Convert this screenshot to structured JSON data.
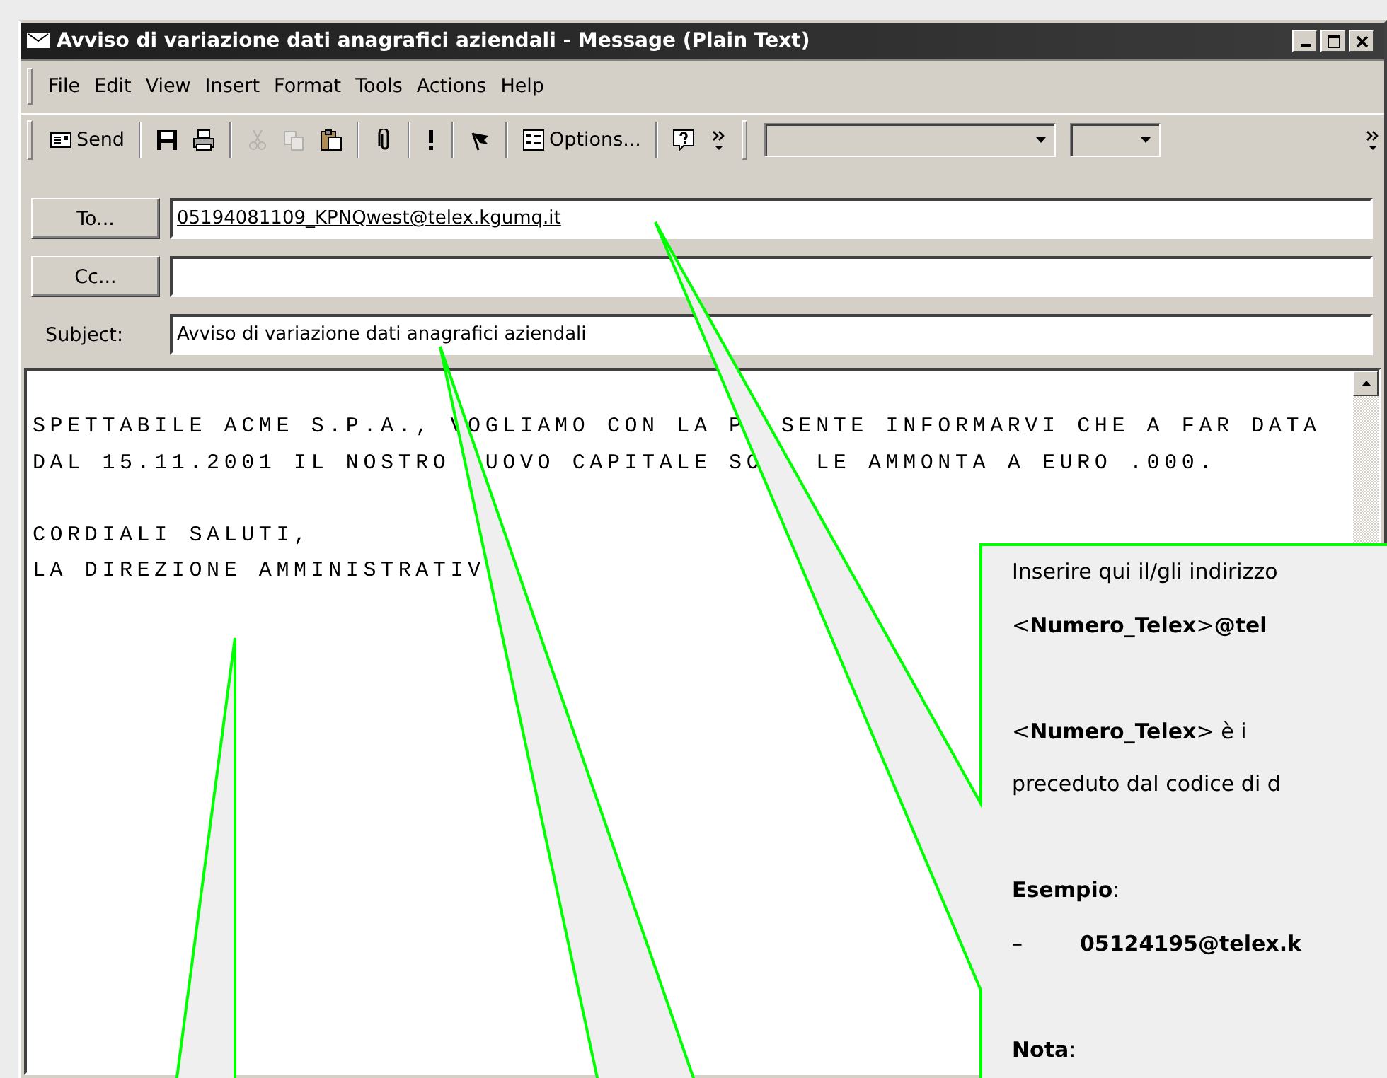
{
  "window": {
    "title": "Avviso di variazione dati anagrafici aziendali - Message (Plain Text)"
  },
  "menu": [
    "File",
    "Edit",
    "View",
    "Insert",
    "Format",
    "Tools",
    "Actions",
    "Help"
  ],
  "toolbar": [
    {
      "kind": "send",
      "label": "Send",
      "disabled": false
    },
    {
      "kind": "separator"
    },
    {
      "kind": "save",
      "disabled": false
    },
    {
      "kind": "print",
      "disabled": false
    },
    {
      "kind": "separator"
    },
    {
      "kind": "cut",
      "disabled": true
    },
    {
      "kind": "copy",
      "disabled": true
    },
    {
      "kind": "paste",
      "disabled": false
    },
    {
      "kind": "separator"
    },
    {
      "kind": "attach",
      "disabled": false
    },
    {
      "kind": "separator"
    },
    {
      "kind": "importance",
      "disabled": false
    },
    {
      "kind": "separator"
    },
    {
      "kind": "flag",
      "disabled": false
    },
    {
      "kind": "separator"
    },
    {
      "kind": "options",
      "label": "Options...",
      "disabled": false
    },
    {
      "kind": "separator"
    },
    {
      "kind": "help",
      "disabled": false
    },
    {
      "kind": "more",
      "disabled": false
    },
    {
      "kind": "grip"
    },
    {
      "kind": "combo"
    },
    {
      "kind": "combo_small"
    },
    {
      "kind": "more",
      "disabled": false
    }
  ],
  "fields": [
    {
      "kind": "button",
      "label": "To...",
      "value": "05194081109_KPNQwest@telex.kgumq.it",
      "underlined": true
    },
    {
      "kind": "button",
      "label": "Cc..."
    },
    {
      "kind": "label",
      "label": "Subject:",
      "value": "Avviso di variazione dati anagrafici aziendali",
      "underlined": false
    }
  ],
  "message": {
    "paragraphs": [
      {
        "lines": [
          "SPETTABILE ACME S.P.A., VOGLIAMO CON LA P  SENTE INFORMARVI CHE A FAR DATA",
          "DAL 15.11.2001 IL NOSTRO  UOVO CAPITALE SO   LE AMMONTA A EURO .000."
        ]
      },
      {
        "lines": [
          "CORDIALI SALUTI,",
          "LA DIREZIONE AMMINISTRATIV"
        ]
      }
    ]
  },
  "callout": {
    "paragraphs": [
      {
        "lines": [
          {
            "text": "Inserire qui il/gli indirizzo"
          },
          {
            "text": "<**Numero_Telex**>**@tel**"
          }
        ]
      },
      {
        "lines": [
          {
            "text": "<**Numero_Telex**> è i"
          },
          {
            "text": "preceduto dal codice di d"
          }
        ]
      },
      {
        "lines": [
          {
            "text": "**Esempio**:"
          },
          {
            "marker": "–",
            "text": "**05124195@telex.k**"
          }
        ]
      },
      {
        "lines": [
          {
            "text": "**Nota**:"
          }
        ]
      }
    ]
  }
}
